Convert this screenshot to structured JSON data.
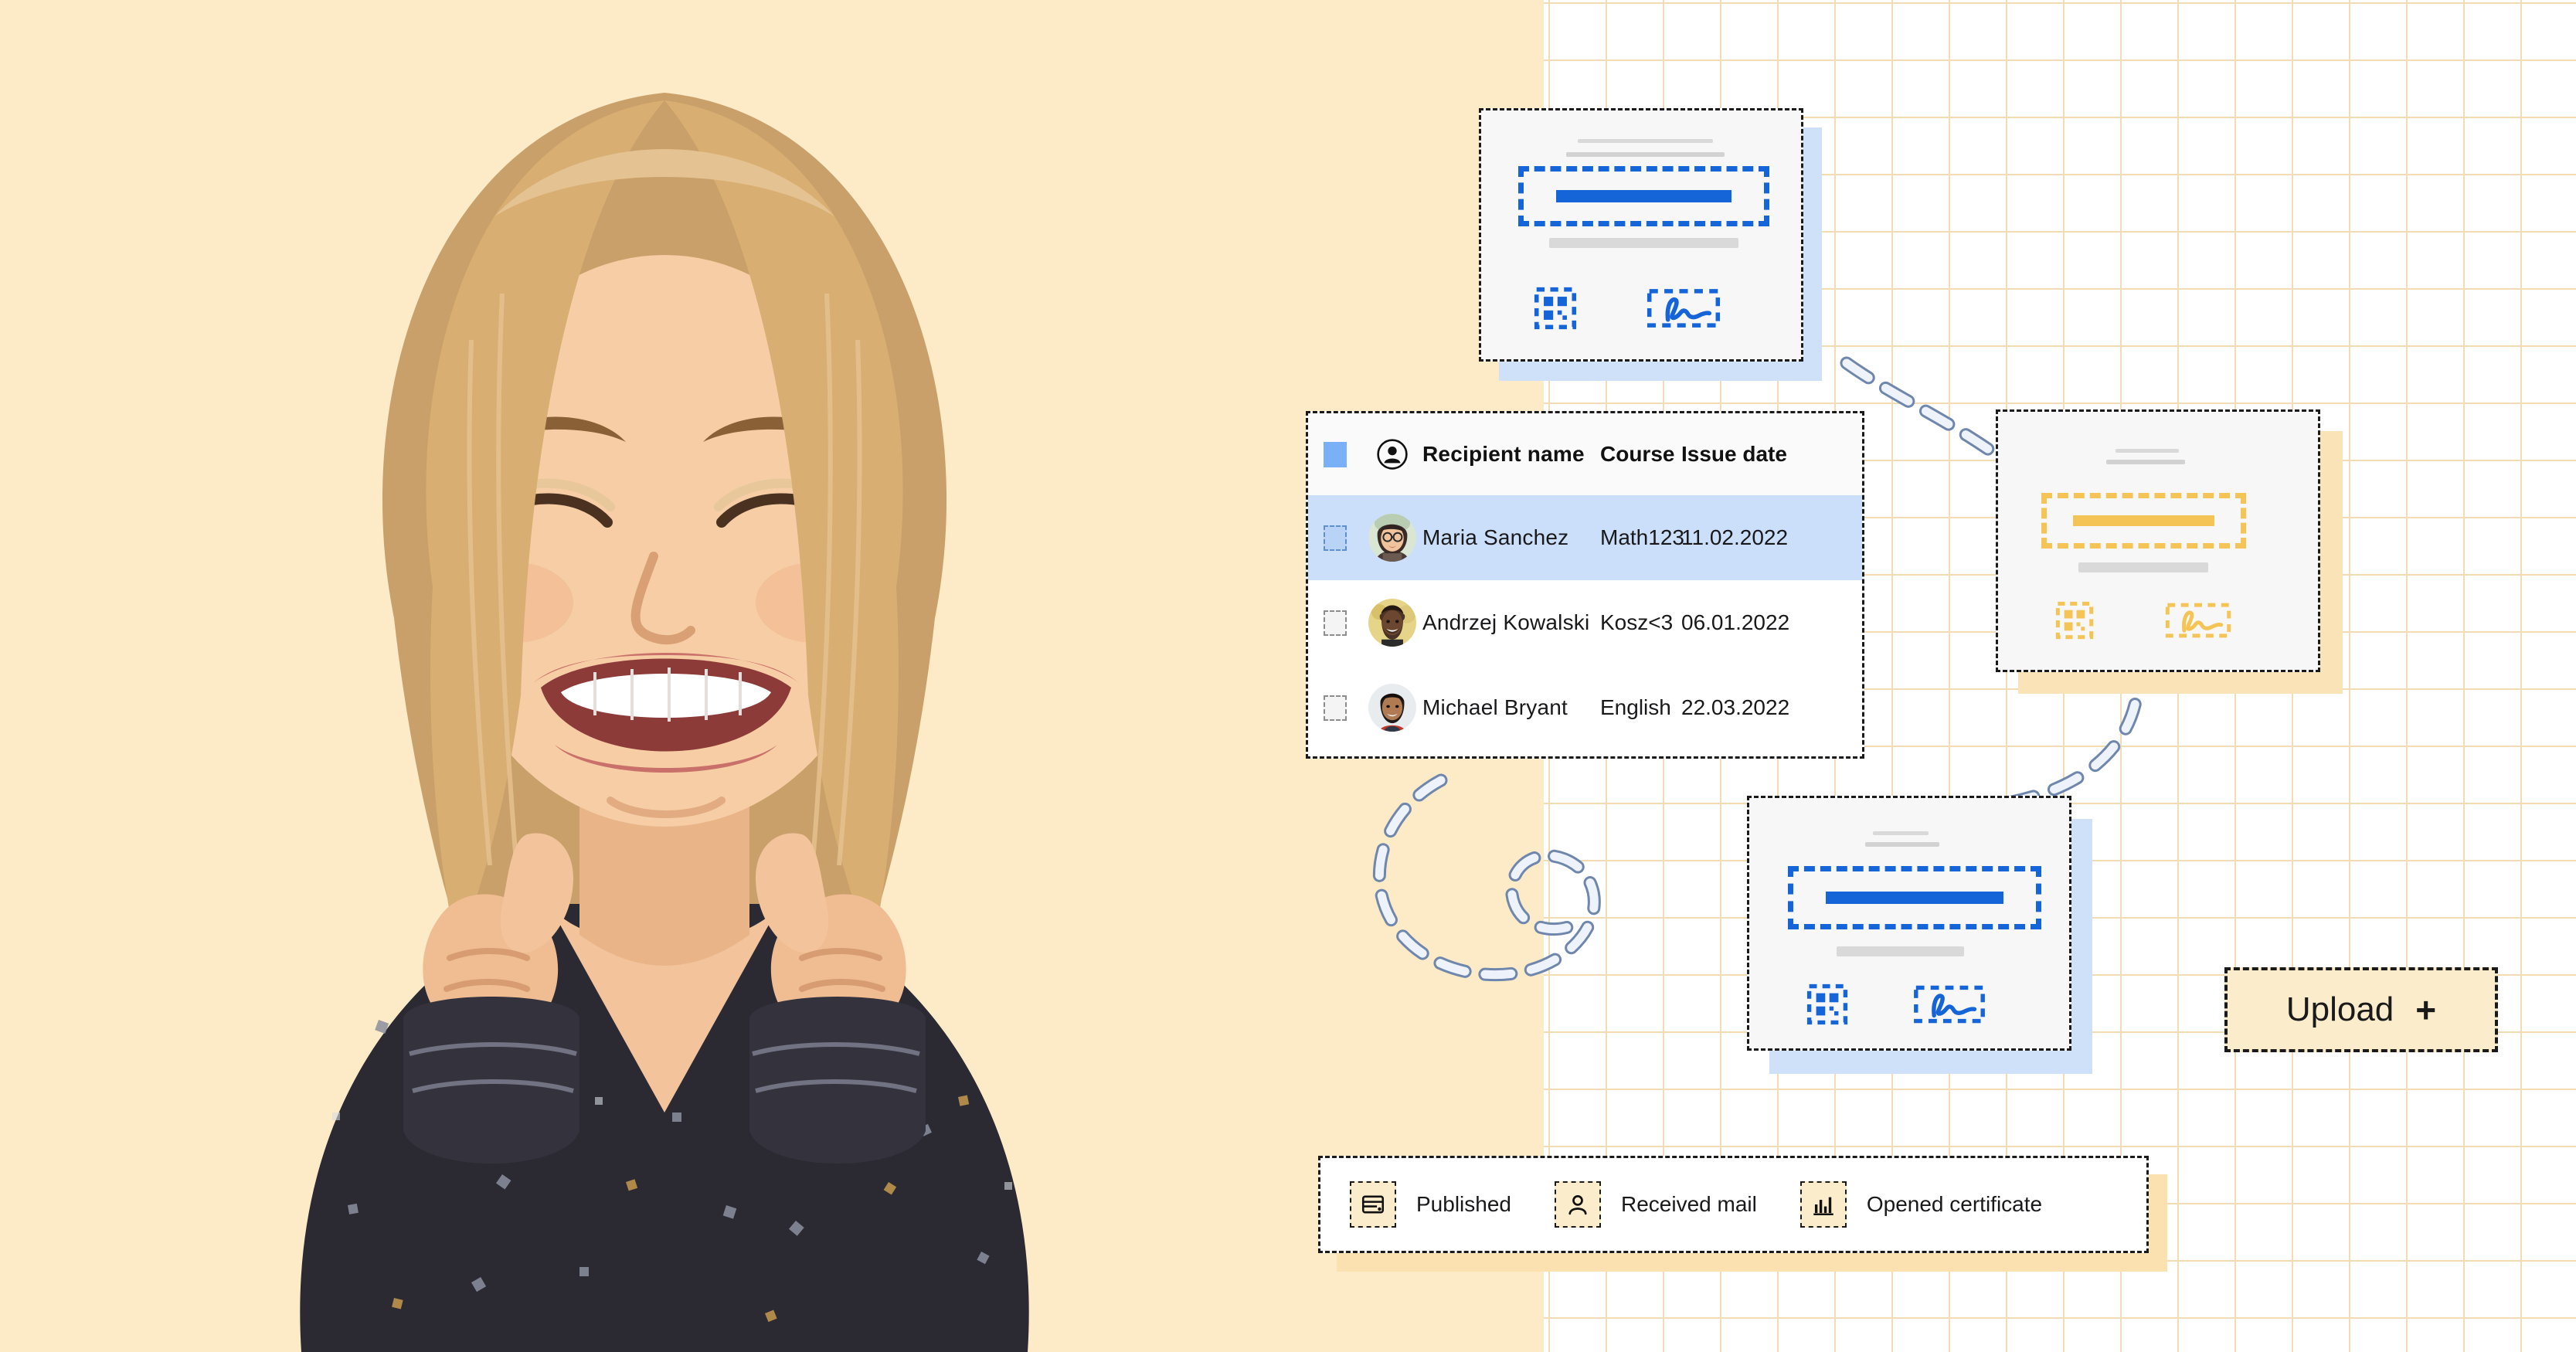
{
  "theme": {
    "tan_bg": "#fdeac7",
    "grid_line": "#f3dcb4",
    "accent_blue": "#1565d8",
    "accent_amber": "#f5c456",
    "row_selected_bg": "#ccdffa",
    "card_bg": "#f7f7f7",
    "ink": "#1a1a1a"
  },
  "portrait": {
    "alt": "smiling-woman-sequin-top",
    "background_color": "#fdeac7"
  },
  "table": {
    "columns": [
      {
        "key": "select",
        "label": "",
        "icon": "checkbox-icon"
      },
      {
        "key": "avatar",
        "label": "",
        "icon": "person-circle-icon"
      },
      {
        "key": "name",
        "label": "Recipient name"
      },
      {
        "key": "course",
        "label": "Course"
      },
      {
        "key": "date",
        "label": "Issue date"
      }
    ],
    "header_select_all_checked": true,
    "rows": [
      {
        "selected": true,
        "checkbox": "checked",
        "avatar": "avatar-maria",
        "name": "Maria Sanchez",
        "course": "Math123",
        "date": "11.02.2022"
      },
      {
        "selected": false,
        "checkbox": "unchecked",
        "avatar": "avatar-andrzej",
        "name": "Andrzej Kowalski",
        "course": "Kosz<3",
        "date": "06.01.2022"
      },
      {
        "selected": false,
        "checkbox": "unchecked",
        "avatar": "avatar-michael",
        "name": "Michael Bryant",
        "course": "English",
        "date": "22.03.2022"
      }
    ]
  },
  "upload": {
    "label": "Upload",
    "plus": "+",
    "icon": "plus-icon"
  },
  "legend": {
    "items": [
      {
        "icon": "published-card-icon",
        "label": "Published"
      },
      {
        "icon": "person-icon",
        "label": "Received mail"
      },
      {
        "icon": "bar-chart-icon",
        "label": "Opened certificate"
      }
    ]
  },
  "certificates": [
    {
      "id": "cert-top",
      "accent": "blue",
      "shadow": "#cfe0f9",
      "icons": [
        "qr-code-icon",
        "signature-icon"
      ]
    },
    {
      "id": "cert-right",
      "accent": "amber",
      "shadow": "#fbe3b8",
      "icons": [
        "qr-code-icon",
        "signature-icon"
      ]
    },
    {
      "id": "cert-bottom",
      "accent": "blue",
      "shadow": "#cfe0f9",
      "icons": [
        "qr-code-icon",
        "signature-icon"
      ]
    }
  ],
  "connectors": [
    {
      "id": "connector-top-right",
      "from": "cert-top",
      "to": "cert-right",
      "style": "dashed-arc"
    },
    {
      "id": "connector-right-bottom",
      "from": "cert-right",
      "to": "cert-bottom",
      "style": "dashed-arc"
    },
    {
      "id": "connector-table-bottom",
      "from": "table",
      "to": "cert-bottom",
      "style": "dashed-spiral"
    }
  ]
}
